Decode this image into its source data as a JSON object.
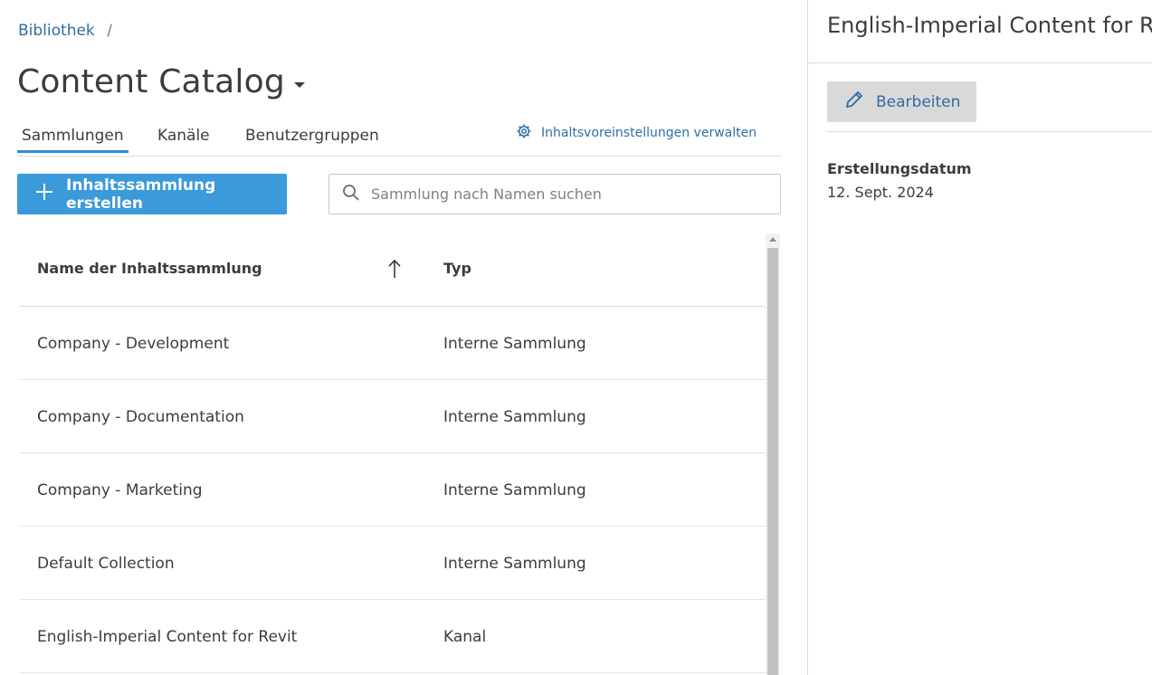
{
  "breadcrumb": {
    "link": "Bibliothek",
    "separator": "/"
  },
  "page": {
    "title": "Content Catalog"
  },
  "tabs": [
    {
      "label": "Sammlungen",
      "active": true
    },
    {
      "label": "Kanäle",
      "active": false
    },
    {
      "label": "Benutzergruppen",
      "active": false
    }
  ],
  "manage_link": {
    "label": "Inhaltsvoreinstellungen verwalten",
    "icon": "gear-icon"
  },
  "create_button": {
    "label": "Inhaltssammlung erstellen",
    "icon": "plus-icon"
  },
  "search": {
    "placeholder": "Sammlung nach Namen suchen",
    "value": "",
    "icon": "search-icon"
  },
  "table": {
    "columns": [
      "Name der Inhaltssammlung",
      "Typ"
    ],
    "sort": "ascending",
    "rows": [
      {
        "name": "Company - Development",
        "type": "Interne Sammlung"
      },
      {
        "name": "Company - Documentation",
        "type": "Interne Sammlung"
      },
      {
        "name": "Company - Marketing",
        "type": "Interne Sammlung"
      },
      {
        "name": "Default Collection",
        "type": "Interne Sammlung"
      },
      {
        "name": "English-Imperial Content for Revit",
        "type": "Kanal"
      }
    ]
  },
  "detail": {
    "title": "English-Imperial Content for R",
    "edit_label": "Bearbeiten",
    "created_label": "Erstellungsdatum",
    "created_value": "12. Sept. 2024"
  },
  "colors": {
    "accent": "#3b9ad9",
    "link": "#2e6da4",
    "edit_bg": "#d9d9d9"
  }
}
